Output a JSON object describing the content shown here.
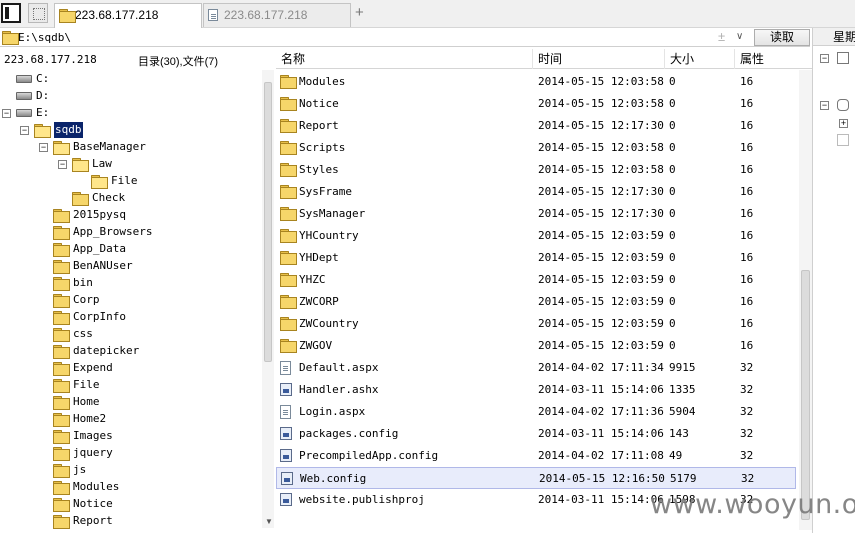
{
  "tabs": {
    "active_label": "223.68.177.218",
    "inactive_label": "223.68.177.218"
  },
  "address": {
    "path": "E:\\sqdb\\",
    "plus_glyph": "±",
    "dropdown_glyph": "∨",
    "read_button": "读取"
  },
  "left": {
    "host": "223.68.177.218",
    "summary": "目录(30),文件(7)"
  },
  "tree": [
    {
      "label": "C:",
      "kind": "drive",
      "depth": 0
    },
    {
      "label": "D:",
      "kind": "drive",
      "depth": 0
    },
    {
      "label": "E:",
      "kind": "drive",
      "depth": 0,
      "expander": "⊟"
    },
    {
      "label": "sqdb",
      "kind": "folder-open",
      "depth": 1,
      "expander": "⊟",
      "selected": true
    },
    {
      "label": "BaseManager",
      "kind": "folder-open",
      "depth": 2,
      "expander": "⊟"
    },
    {
      "label": "Law",
      "kind": "folder-open",
      "depth": 3,
      "expander": "⊟"
    },
    {
      "label": "File",
      "kind": "folder-open",
      "depth": 4
    },
    {
      "label": "Check",
      "kind": "folder",
      "depth": 3
    },
    {
      "label": "2015pysq",
      "kind": "folder",
      "depth": 2
    },
    {
      "label": "App_Browsers",
      "kind": "folder",
      "depth": 2
    },
    {
      "label": "App_Data",
      "kind": "folder",
      "depth": 2
    },
    {
      "label": "BenANUser",
      "kind": "folder",
      "depth": 2
    },
    {
      "label": "bin",
      "kind": "folder",
      "depth": 2
    },
    {
      "label": "Corp",
      "kind": "folder",
      "depth": 2
    },
    {
      "label": "CorpInfo",
      "kind": "folder",
      "depth": 2
    },
    {
      "label": "css",
      "kind": "folder",
      "depth": 2
    },
    {
      "label": "datepicker",
      "kind": "folder",
      "depth": 2
    },
    {
      "label": "Expend",
      "kind": "folder",
      "depth": 2
    },
    {
      "label": "File",
      "kind": "folder",
      "depth": 2
    },
    {
      "label": "Home",
      "kind": "folder",
      "depth": 2
    },
    {
      "label": "Home2",
      "kind": "folder",
      "depth": 2
    },
    {
      "label": "Images",
      "kind": "folder",
      "depth": 2
    },
    {
      "label": "jquery",
      "kind": "folder",
      "depth": 2
    },
    {
      "label": "js",
      "kind": "folder",
      "depth": 2
    },
    {
      "label": "Modules",
      "kind": "folder",
      "depth": 2
    },
    {
      "label": "Notice",
      "kind": "folder",
      "depth": 2
    },
    {
      "label": "Report",
      "kind": "folder",
      "depth": 2
    }
  ],
  "list": {
    "headers": {
      "name": "名称",
      "time": "时间",
      "size": "大小",
      "attr": "属性"
    },
    "rows": [
      {
        "name": "Modules",
        "time": "2014-05-15 12:03:58",
        "size": "0",
        "attr": "16",
        "icon": "folder"
      },
      {
        "name": "Notice",
        "time": "2014-05-15 12:03:58",
        "size": "0",
        "attr": "16",
        "icon": "folder"
      },
      {
        "name": "Report",
        "time": "2014-05-15 12:17:30",
        "size": "0",
        "attr": "16",
        "icon": "folder"
      },
      {
        "name": "Scripts",
        "time": "2014-05-15 12:03:58",
        "size": "0",
        "attr": "16",
        "icon": "folder"
      },
      {
        "name": "Styles",
        "time": "2014-05-15 12:03:58",
        "size": "0",
        "attr": "16",
        "icon": "folder"
      },
      {
        "name": "SysFrame",
        "time": "2014-05-15 12:17:30",
        "size": "0",
        "attr": "16",
        "icon": "folder"
      },
      {
        "name": "SysManager",
        "time": "2014-05-15 12:17:30",
        "size": "0",
        "attr": "16",
        "icon": "folder"
      },
      {
        "name": "YHCountry",
        "time": "2014-05-15 12:03:59",
        "size": "0",
        "attr": "16",
        "icon": "folder"
      },
      {
        "name": "YHDept",
        "time": "2014-05-15 12:03:59",
        "size": "0",
        "attr": "16",
        "icon": "folder"
      },
      {
        "name": "YHZC",
        "time": "2014-05-15 12:03:59",
        "size": "0",
        "attr": "16",
        "icon": "folder"
      },
      {
        "name": "ZWCORP",
        "time": "2014-05-15 12:03:59",
        "size": "0",
        "attr": "16",
        "icon": "folder"
      },
      {
        "name": "ZWCountry",
        "time": "2014-05-15 12:03:59",
        "size": "0",
        "attr": "16",
        "icon": "folder"
      },
      {
        "name": "ZWGOV",
        "time": "2014-05-15 12:03:59",
        "size": "0",
        "attr": "16",
        "icon": "folder"
      },
      {
        "name": "Default.aspx",
        "time": "2014-04-02 17:11:34",
        "size": "9915",
        "attr": "32",
        "icon": "doc"
      },
      {
        "name": "Handler.ashx",
        "time": "2014-03-11 15:14:06",
        "size": "1335",
        "attr": "32",
        "icon": "cfg"
      },
      {
        "name": "Login.aspx",
        "time": "2014-04-02 17:11:36",
        "size": "5904",
        "attr": "32",
        "icon": "doc"
      },
      {
        "name": "packages.config",
        "time": "2014-03-11 15:14:06",
        "size": "143",
        "attr": "32",
        "icon": "cfg"
      },
      {
        "name": "PrecompiledApp.config",
        "time": "2014-04-02 17:11:08",
        "size": "49",
        "attr": "32",
        "icon": "cfg"
      },
      {
        "name": "Web.config",
        "time": "2014-05-15 12:16:50",
        "size": "5179",
        "attr": "32",
        "icon": "cfg",
        "selected": true
      },
      {
        "name": "website.publishproj",
        "time": "2014-03-11 15:14:06",
        "size": "1598",
        "attr": "32",
        "icon": "cfg"
      }
    ]
  },
  "rpanel": {
    "header": "星期"
  },
  "watermark": "www.wooyun.org"
}
